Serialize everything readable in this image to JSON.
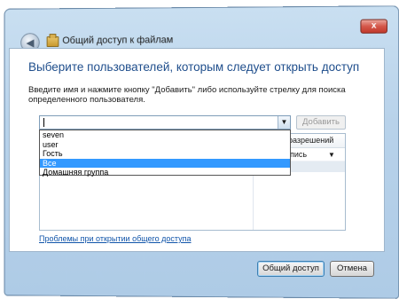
{
  "window": {
    "title": "Общий доступ к файлам",
    "close_label": "x",
    "back_icon": "back-arrow-icon",
    "title_icon": "file-share-icon"
  },
  "main": {
    "heading": "Выберите пользователей, которым следует открыть доступ",
    "instructions": "Введите имя и нажмите кнопку \"Добавить\" либо используйте стрелку для поиска определенного пользователя.",
    "input_value": "",
    "add_button": "Добавить"
  },
  "dropdown": {
    "options": [
      "seven",
      "user",
      "Гость",
      "Все",
      "Домашняя группа"
    ],
    "selected_index": 3
  },
  "grid": {
    "permission_header": "разрешений",
    "row_permission": "пись"
  },
  "link": "Проблемы при открытии общего доступа",
  "footer": {
    "share_button": "Общий доступ",
    "cancel_button": "Отмена"
  },
  "colors": {
    "heading": "#1f4e8c",
    "selection": "#3399ff",
    "link": "#1155aa",
    "close": "#c23a2c"
  }
}
